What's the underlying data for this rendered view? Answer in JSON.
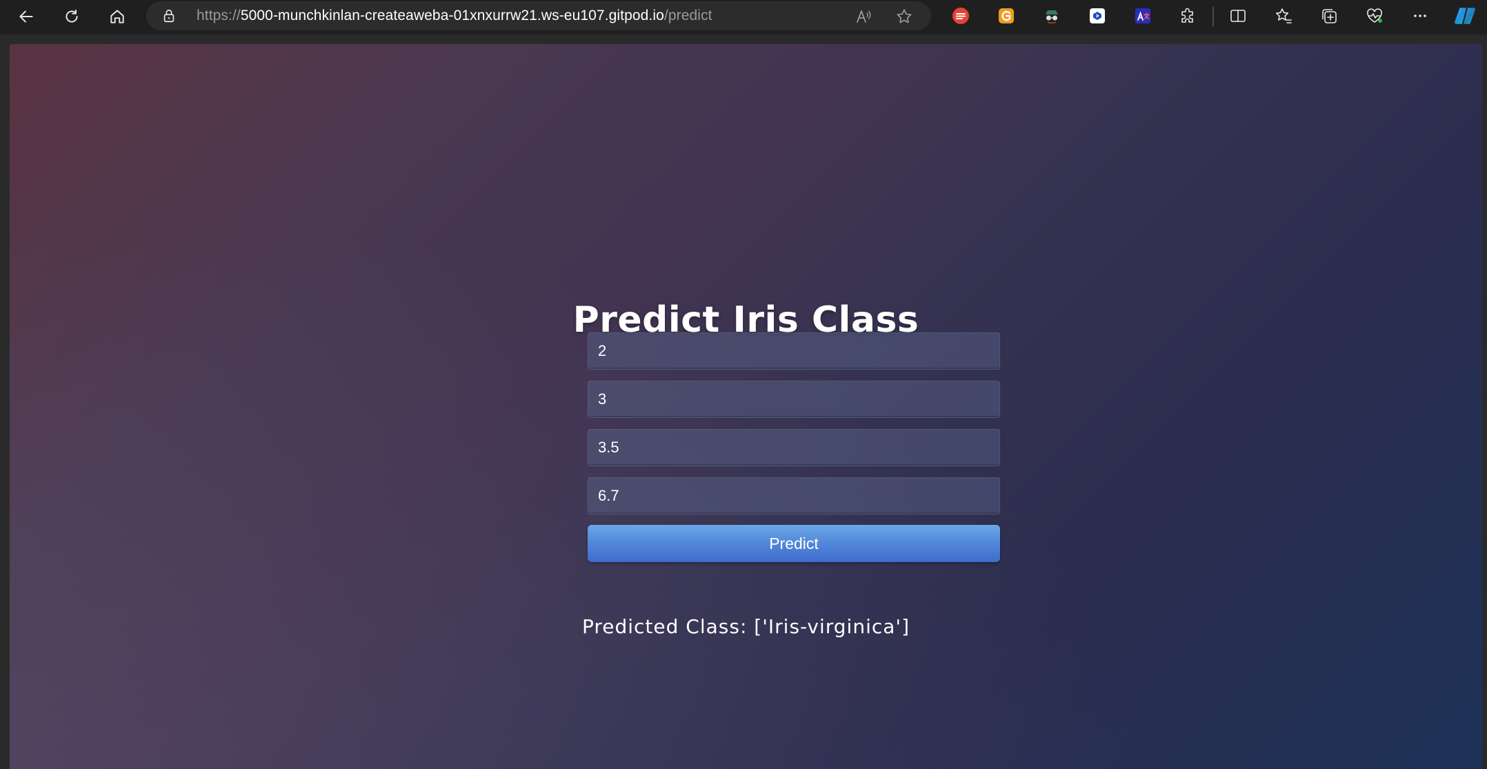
{
  "browser": {
    "url_prefix": "https://",
    "url_host": "5000-munchkinlan-createaweba-01xnxurrw21.ws-eu107.gitpod.io",
    "url_path": "/predict",
    "icons": {
      "back": "back-arrow-icon",
      "refresh": "refresh-icon",
      "home": "home-icon",
      "lock": "lock-icon",
      "read_aloud": "read-aloud-icon",
      "favorite": "star-icon",
      "split_screen": "split-screen-icon",
      "favorites": "favorites-icon",
      "collections": "collections-icon",
      "performance": "heartbeat-icon",
      "more": "more-icon",
      "copilot": "copilot-icon"
    },
    "extensions": [
      "todoist-icon",
      "grammarly-icon",
      "spy-icon",
      "terminal-icon",
      "translate-icon",
      "puzzle-icon"
    ]
  },
  "page": {
    "title": "Predict Iris Class",
    "inputs": [
      {
        "value": "2"
      },
      {
        "value": "3"
      },
      {
        "value": "3.5"
      },
      {
        "value": "6.7"
      }
    ],
    "button_label": "Predict",
    "result": "Predicted Class: ['Iris-virginica']"
  },
  "colors": {
    "button": "#4f84d8",
    "gradient_start": "#5a3342",
    "gradient_end": "#1e3258"
  }
}
